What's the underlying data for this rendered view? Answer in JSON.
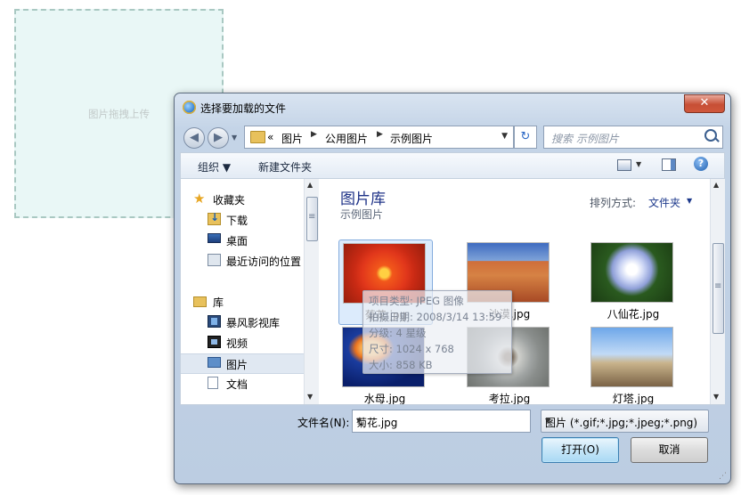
{
  "dropzone": {
    "hint": "图片拖拽上传"
  },
  "dialog": {
    "title": "选择要加载的文件",
    "close_label": "✕",
    "address": {
      "overflow": "«",
      "crumbs": [
        "图片",
        "公用图片",
        "示例图片"
      ]
    },
    "search_placeholder": "搜索 示例图片",
    "toolbar": {
      "organize": "组织 ▼",
      "new_folder": "新建文件夹",
      "help": "?"
    },
    "nav": {
      "items": [
        {
          "label": "收藏夹",
          "icon": "star-icon"
        },
        {
          "label": "下载",
          "icon": "downloads-folder-icon"
        },
        {
          "label": "桌面",
          "icon": "desktop-icon"
        },
        {
          "label": "最近访问的位置",
          "icon": "recent-places-icon"
        },
        {
          "label": "库",
          "icon": "library-icon"
        },
        {
          "label": "暴风影视库",
          "icon": "film-library-icon"
        },
        {
          "label": "视频",
          "icon": "video-library-icon"
        },
        {
          "label": "图片",
          "icon": "pictures-library-icon",
          "selected": true
        },
        {
          "label": "文档",
          "icon": "documents-library-icon"
        }
      ]
    },
    "library": {
      "title": "图片库",
      "subtitle": "示例图片",
      "arrange_label": "排列方式:",
      "arrange_value": "文件夹"
    },
    "files": [
      {
        "name": "菊花.jpg",
        "selected": true
      },
      {
        "name": "沙漠.jpg"
      },
      {
        "name": "八仙花.jpg"
      },
      {
        "name": "水母.jpg"
      },
      {
        "name": "考拉.jpg"
      },
      {
        "name": "灯塔.jpg"
      }
    ],
    "tooltip": {
      "type": "项目类型: JPEG 图像",
      "date": "拍摄日期: 2008/3/14 13:59",
      "rating": "分级: 4 星级",
      "dimensions": "尺寸: 1024 x 768",
      "size": "大小: 858 KB"
    },
    "filename_label": "文件名(N):",
    "filename_value": "菊花.jpg",
    "filetype_value": "图片 (*.gif;*.jpg;*.jpeg;*.png)",
    "open_label": "打开(O)",
    "cancel_label": "取消"
  }
}
